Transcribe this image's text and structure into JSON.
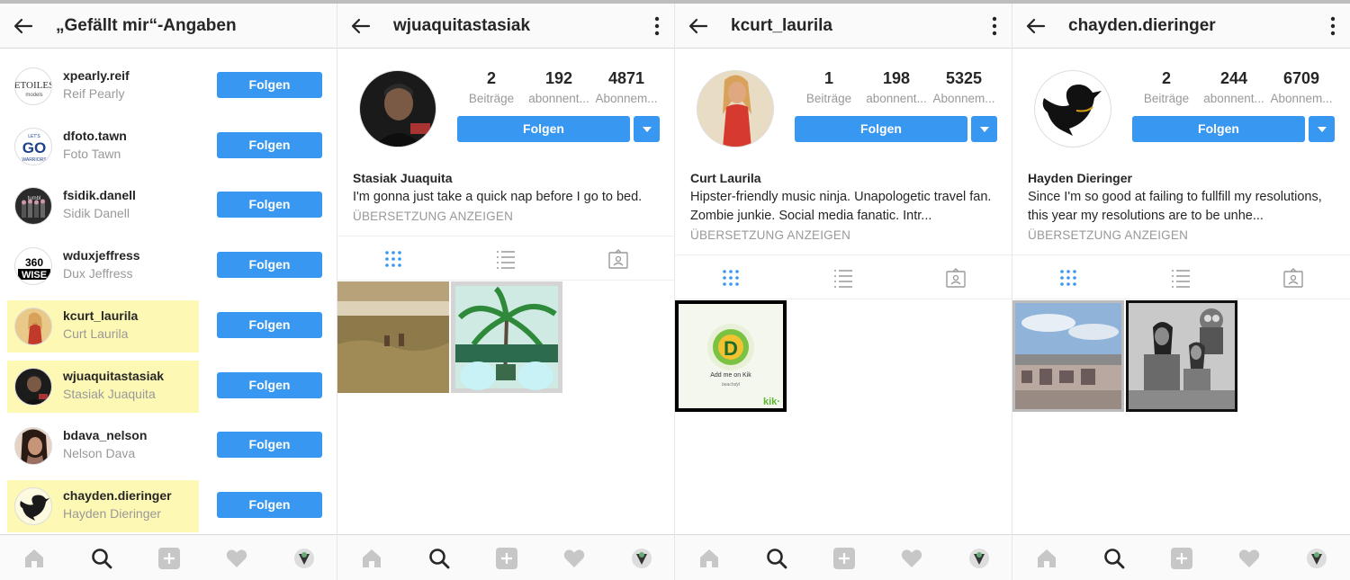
{
  "likes_panel": {
    "title": "„Gefällt mir“-Angaben",
    "users": [
      {
        "username": "xpearly.reif",
        "name": "Reif Pearly",
        "button": "Folgen",
        "highlighted": false,
        "avatar": "etoiles-logo"
      },
      {
        "username": "dfoto.tawn",
        "name": "Foto Tawn",
        "button": "Folgen",
        "highlighted": false,
        "avatar": "lets-go-logo"
      },
      {
        "username": "fsidik.danell",
        "name": "Sidik Danell",
        "button": "Folgen",
        "highlighted": false,
        "avatar": "group-photo"
      },
      {
        "username": "wduxjeffress",
        "name": "Dux Jeffress",
        "button": "Folgen",
        "highlighted": false,
        "avatar": "360-wise-logo"
      },
      {
        "username": "kcurt_laurila",
        "name": "Curt Laurila",
        "button": "Folgen",
        "highlighted": true,
        "avatar": "woman-red-dress"
      },
      {
        "username": "wjuaquitastasiak",
        "name": "Stasiak Juaquita",
        "button": "Folgen",
        "highlighted": true,
        "avatar": "man-portrait"
      },
      {
        "username": "bdava_nelson",
        "name": "Nelson Dava",
        "button": "Folgen",
        "highlighted": false,
        "avatar": "woman-portrait"
      },
      {
        "username": "chayden.dieringer",
        "name": "Hayden Dieringer",
        "button": "Folgen",
        "highlighted": true,
        "avatar": "black-bird"
      }
    ]
  },
  "profiles": [
    {
      "username": "wjuaquitastasiak",
      "posts": "2",
      "posts_label": "Beiträge",
      "followers": "192",
      "followers_label": "abonnent...",
      "following": "4871",
      "following_label": "Abonnem...",
      "follow_label": "Folgen",
      "full_name": "Stasiak Juaquita",
      "bio": "I'm gonna just take a quick nap before I go to bed.",
      "translate": "ÜBERSETZUNG ANZEIGEN",
      "thumbs": [
        "savanna-photo",
        "palm-tree-photo"
      ]
    },
    {
      "username": "kcurt_laurila",
      "posts": "1",
      "posts_label": "Beiträge",
      "followers": "198",
      "followers_label": "abonnent...",
      "following": "5325",
      "following_label": "Abonnem...",
      "follow_label": "Folgen",
      "full_name": "Curt Laurila",
      "bio": "Hipster-friendly music ninja. Unapologetic travel fan. Zombie junkie. Social media fanatic. Intr...",
      "translate": "ÜBERSETZUNG ANZEIGEN",
      "thumbs": [
        "kik-card"
      ],
      "kik": {
        "letter": "D",
        "text": "Add me on Kik",
        "sub": "beachdyl",
        "brand": "kik·"
      }
    },
    {
      "username": "chayden.dieringer",
      "posts": "2",
      "posts_label": "Beiträge",
      "followers": "244",
      "followers_label": "abonnent...",
      "following": "6709",
      "following_label": "Abonnem...",
      "follow_label": "Folgen",
      "full_name": "Hayden Dieringer",
      "bio": "Since I'm so good at failing to fullfill my resolutions, this year my resolutions are to be unhe...",
      "translate": "ÜBERSETZUNG ANZEIGEN",
      "thumbs": [
        "graffiti-sky-photo",
        "kids-minion-photo"
      ]
    }
  ],
  "avatar_logos": {
    "etoiles": "ETOILES",
    "etoiles_sub": "models",
    "letsgo": "GO",
    "letsgo_top": "LET'S",
    "letsgo_bottom": "WARRIORS",
    "wise_top": "360",
    "wise_bottom": "WISE",
    "tumblr": "tumbl"
  },
  "nav_icons": [
    "home-icon",
    "search-icon",
    "add-icon",
    "heart-icon",
    "profile-icon"
  ],
  "colors": {
    "accent": "#3897f0",
    "highlight": "#fdf8b3",
    "muted": "#999999"
  }
}
